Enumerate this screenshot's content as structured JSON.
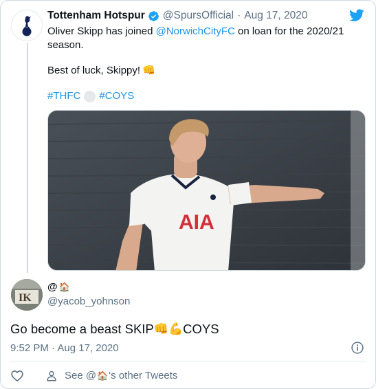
{
  "parent_tweet": {
    "display_name": "Tottenham Hotspur",
    "handle": "@SpursOfficial",
    "separator": "·",
    "date": "Aug 17, 2020",
    "text_prefix": "Oliver Skipp has joined ",
    "mention": "@NorwichCityFC",
    "text_suffix": " on loan for the 2020/21 season.",
    "line2": "Best of luck, Skippy! ",
    "line2_emoji": "👊",
    "hashtag1": "#THFC",
    "hashtag2": "#COYS",
    "verified_icon": "verified-badge-icon",
    "brand_icon": "twitter-bird-icon",
    "photo_subject": "AIA",
    "colors": {
      "link": "#1b95e0",
      "verified": "#1da1f2",
      "secondary_text": "#5b7083"
    }
  },
  "reply_tweet": {
    "display_name": "@",
    "name_emoji": "🏠",
    "handle": "@yacob_yohnson",
    "text": "Go become a beast SKIP",
    "emoji1": "👊",
    "emoji2": "💪",
    "text_end": "COYS",
    "time": "9:52 PM · Aug 17, 2020",
    "avatar_text": "IK"
  },
  "footer": {
    "see_prefix": "See @",
    "see_emoji": "🏠",
    "see_suffix": "'s other Tweets"
  }
}
